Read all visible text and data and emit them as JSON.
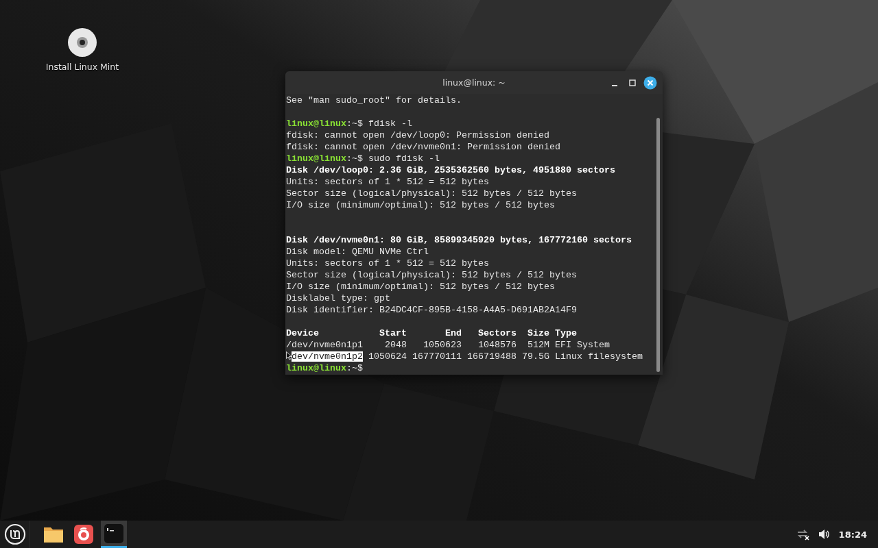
{
  "desktop": {
    "icons": [
      {
        "label": "Install Linux Mint"
      }
    ]
  },
  "terminal": {
    "title": "linux@linux: ~",
    "lines": [
      {
        "kind": "text",
        "text": "See \"man sudo_root\" for details."
      },
      {
        "kind": "blank"
      },
      {
        "kind": "prompt",
        "user": "linux@linux",
        "path": ":~$",
        "command": "fdisk -l"
      },
      {
        "kind": "text",
        "text": "fdisk: cannot open /dev/loop0: Permission denied"
      },
      {
        "kind": "text",
        "text": "fdisk: cannot open /dev/nvme0n1: Permission denied"
      },
      {
        "kind": "prompt",
        "user": "linux@linux",
        "path": ":~$",
        "command": "sudo fdisk -l"
      },
      {
        "kind": "bold",
        "text": "Disk /dev/loop0: 2.36 GiB, 2535362560 bytes, 4951880 sectors"
      },
      {
        "kind": "text",
        "text": "Units: sectors of 1 * 512 = 512 bytes"
      },
      {
        "kind": "text",
        "text": "Sector size (logical/physical): 512 bytes / 512 bytes"
      },
      {
        "kind": "text",
        "text": "I/O size (minimum/optimal): 512 bytes / 512 bytes"
      },
      {
        "kind": "blank"
      },
      {
        "kind": "blank"
      },
      {
        "kind": "bold",
        "text": "Disk /dev/nvme0n1: 80 GiB, 85899345920 bytes, 167772160 sectors"
      },
      {
        "kind": "text",
        "text": "Disk model: QEMU NVMe Ctrl"
      },
      {
        "kind": "text",
        "text": "Units: sectors of 1 * 512 = 512 bytes"
      },
      {
        "kind": "text",
        "text": "Sector size (logical/physical): 512 bytes / 512 bytes"
      },
      {
        "kind": "text",
        "text": "I/O size (minimum/optimal): 512 bytes / 512 bytes"
      },
      {
        "kind": "text",
        "text": "Disklabel type: gpt"
      },
      {
        "kind": "text",
        "text": "Disk identifier: B24DC4CF-895B-4158-A4A5-D691AB2A14F9"
      },
      {
        "kind": "blank"
      },
      {
        "kind": "bold",
        "text": "Device           Start       End   Sectors  Size Type"
      },
      {
        "kind": "text",
        "text": "/dev/nvme0n1p1    2048   1050623   1048576  512M EFI System"
      },
      {
        "kind": "segments",
        "segments": [
          {
            "kind": "pointer"
          },
          {
            "text": "dev/nvme0n1p2",
            "selected": true
          },
          {
            "text": " 1050624 167770111 166719488 79.5G Linux filesystem",
            "selected": false
          }
        ]
      },
      {
        "kind": "prompt",
        "user": "linux@linux",
        "path": ":~$"
      }
    ]
  },
  "taskbar": {
    "launchers": [
      {
        "kind": "folder",
        "selected": false
      },
      {
        "kind": "browser",
        "selected": false
      },
      {
        "kind": "terminal",
        "selected": true
      }
    ],
    "clock": "18:24"
  }
}
